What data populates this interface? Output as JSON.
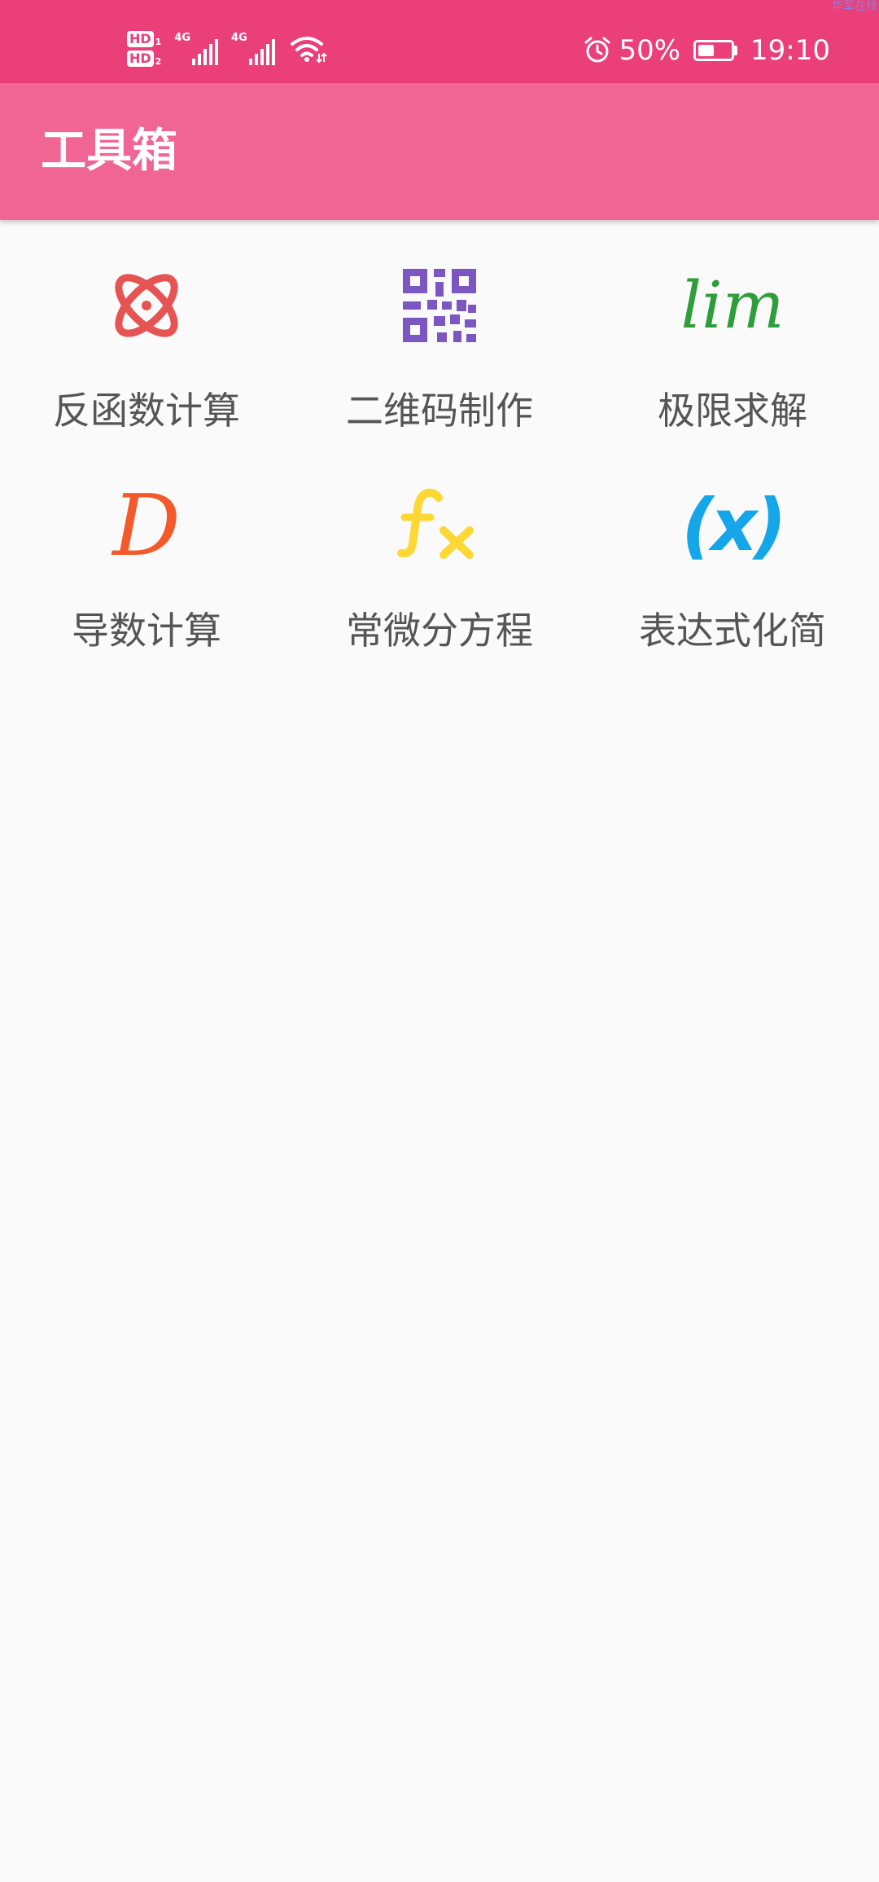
{
  "status_bar": {
    "hd1": "HD",
    "hd1_sub": "1",
    "hd2": "HD",
    "hd2_sub": "2",
    "sig1_label": "4G",
    "sig2_label": "4G",
    "battery_percent": "50%",
    "battery_level": 0.5,
    "time": "19:10",
    "corner_text": "华军在线"
  },
  "app_bar": {
    "title": "工具箱"
  },
  "tools": [
    {
      "label": "反函数计算",
      "icon": "atom-icon",
      "color": "#e55353"
    },
    {
      "label": "二维码制作",
      "icon": "qr-code-icon",
      "color": "#7d57c1",
      "glyph": ""
    },
    {
      "label": "极限求解",
      "icon": "lim-icon",
      "color": "#2e9e3a",
      "glyph": "lim"
    },
    {
      "label": "导数计算",
      "icon": "derivative-d-icon",
      "color": "#f4592a",
      "glyph": "D"
    },
    {
      "label": "常微分方程",
      "icon": "fx-icon",
      "color": "#fdd835"
    },
    {
      "label": "表达式化简",
      "icon": "parenthesis-x-icon",
      "color": "#14a6e8",
      "glyph": "(x)"
    }
  ],
  "colors": {
    "status_bar": "#ea3f78",
    "app_bar": "#f06594",
    "background": "#fafafa",
    "label_text": "#555555"
  }
}
